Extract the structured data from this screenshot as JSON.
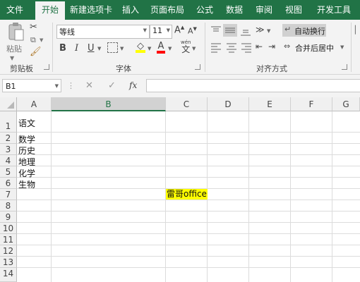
{
  "tabs": [
    "文件",
    "开始",
    "新建选项卡",
    "插入",
    "页面布局",
    "公式",
    "数据",
    "审阅",
    "视图",
    "开发工具"
  ],
  "ribbon": {
    "clipboard": {
      "paste_label": "粘贴",
      "group_label": "剪贴板"
    },
    "font": {
      "font_name": "等线",
      "font_size": "11",
      "bold": "B",
      "italic": "I",
      "underline": "U",
      "grow": "A",
      "shrink": "A",
      "font_color": "A",
      "phonetic": "wén",
      "phonetic_char": "文",
      "group_label": "字体"
    },
    "alignment": {
      "wrap_text": "自动换行",
      "merge_center": "合并后居中",
      "group_label": "对齐方式"
    }
  },
  "formula_bar": {
    "name_box": "B1",
    "fx": "fx",
    "value": ""
  },
  "columns": [
    "A",
    "B",
    "C",
    "D",
    "E",
    "F",
    "G"
  ],
  "rows": [
    "1",
    "2",
    "3",
    "4",
    "5",
    "6",
    "7",
    "8",
    "9",
    "10",
    "11",
    "12",
    "13",
    "14"
  ],
  "cells": {
    "A1": "语文",
    "A2": "数学",
    "A3": "历史",
    "A4": "地理",
    "A5": "化学",
    "A6": "生物",
    "C7": "雷哥office"
  },
  "colors": {
    "accent": "#217346",
    "highlight": "#ffff00"
  }
}
